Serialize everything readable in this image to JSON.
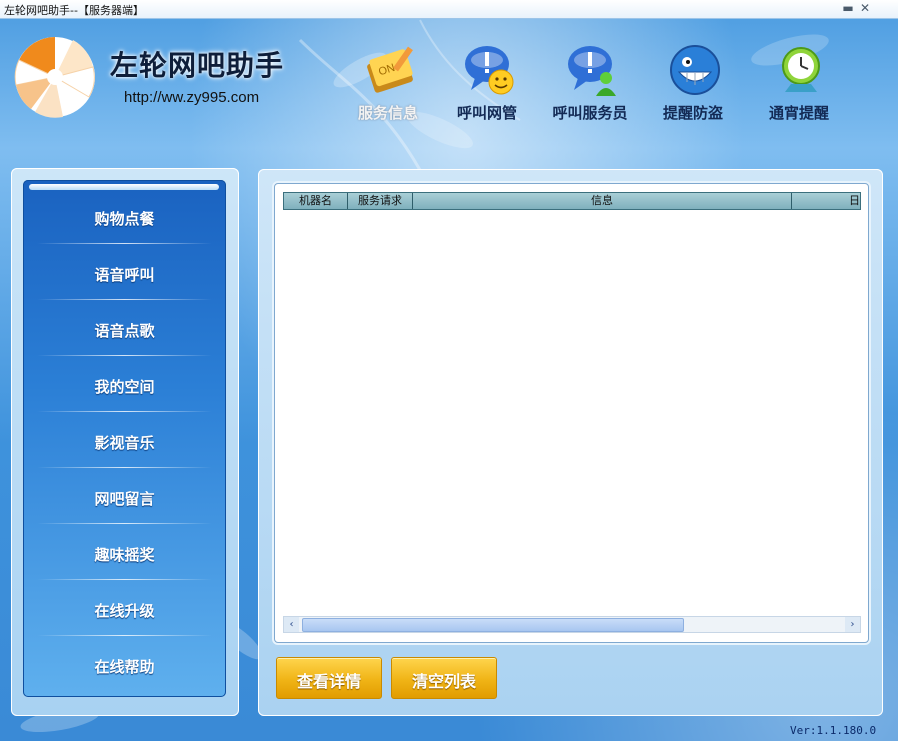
{
  "window": {
    "title": "左轮网吧助手--【服务器端】",
    "min_glyph": "▬",
    "close_glyph": "✕"
  },
  "header": {
    "app_name": "左轮网吧助手",
    "url": "http://ww.zy995.com"
  },
  "toolbar": {
    "items": [
      {
        "label": "服务信息",
        "icon": "notepad-on-icon",
        "active": true
      },
      {
        "label": "呼叫网管",
        "icon": "chat-smiley-icon"
      },
      {
        "label": "呼叫服务员",
        "icon": "chat-user-icon"
      },
      {
        "label": "提醒防盗",
        "icon": "grinning-face-icon"
      },
      {
        "label": "通宵提醒",
        "icon": "alarm-clock-icon"
      }
    ]
  },
  "sidebar": {
    "items": [
      {
        "label": "购物点餐"
      },
      {
        "label": "语音呼叫"
      },
      {
        "label": "语音点歌"
      },
      {
        "label": "我的空间"
      },
      {
        "label": "影视音乐"
      },
      {
        "label": "网吧留言"
      },
      {
        "label": "趣味摇奖"
      },
      {
        "label": "在线升级"
      },
      {
        "label": "在线帮助"
      }
    ]
  },
  "table": {
    "columns": [
      "机器名",
      "服务请求",
      "信息",
      "日"
    ],
    "rows": []
  },
  "scrollbar": {
    "left_glyph": "‹",
    "right_glyph": "›"
  },
  "actions": {
    "details_label": "查看详情",
    "clear_label": "清空列表"
  },
  "footer": {
    "version": "Ver:1.1.180.0"
  },
  "colors": {
    "accent_orange": "#f08a1c",
    "button_gold": "#f0b416",
    "sidebar_blue": "#1a62c0"
  }
}
